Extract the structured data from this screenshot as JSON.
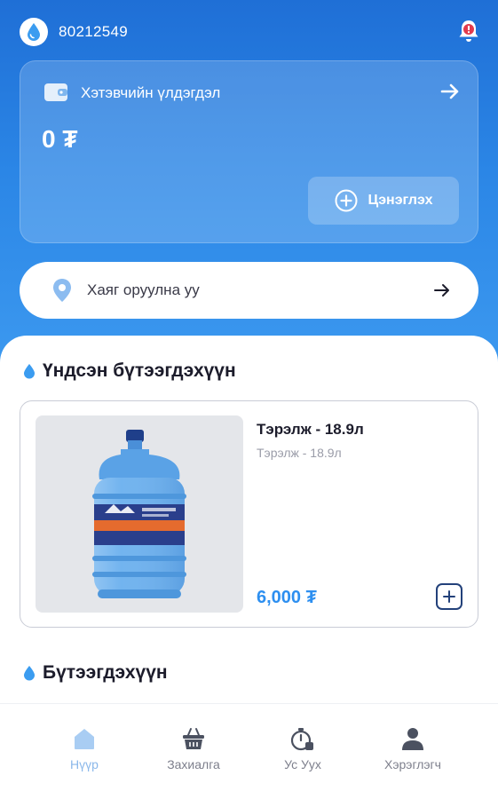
{
  "header": {
    "phone_number": "80212549",
    "avatar_icon": "water-drop-icon",
    "notification_icon": "bell-icon"
  },
  "wallet": {
    "title": "Хэтэвчийн үлдэгдэл",
    "balance": "0 ₮",
    "topup_label": "Цэнэглэх",
    "icon": "wallet-icon"
  },
  "address": {
    "placeholder": "Хаяг оруулна уу",
    "icon": "location-pin-icon"
  },
  "main_section": {
    "title": "Үндсэн бүтээгдэхүүн"
  },
  "product": {
    "name": "Тэрэлж - 18.9л",
    "subtitle": "Тэрэлж - 18.9л",
    "price": "6,000 ₮"
  },
  "products_section": {
    "title": "Бүтээгдэхүүн"
  },
  "nav": {
    "items": [
      {
        "label": "Нүүр",
        "icon": "home-icon",
        "active": true
      },
      {
        "label": "Захиалга",
        "icon": "basket-icon",
        "active": false
      },
      {
        "label": "Ус Уух",
        "icon": "water-timer-icon",
        "active": false
      },
      {
        "label": "Хэрэглэгч",
        "icon": "user-icon",
        "active": false
      }
    ]
  },
  "colors": {
    "primary_blue": "#2b86e6",
    "price_blue": "#2d8ff0",
    "nav_active": "#8ab7ea",
    "notification_red": "#e23a4e"
  }
}
